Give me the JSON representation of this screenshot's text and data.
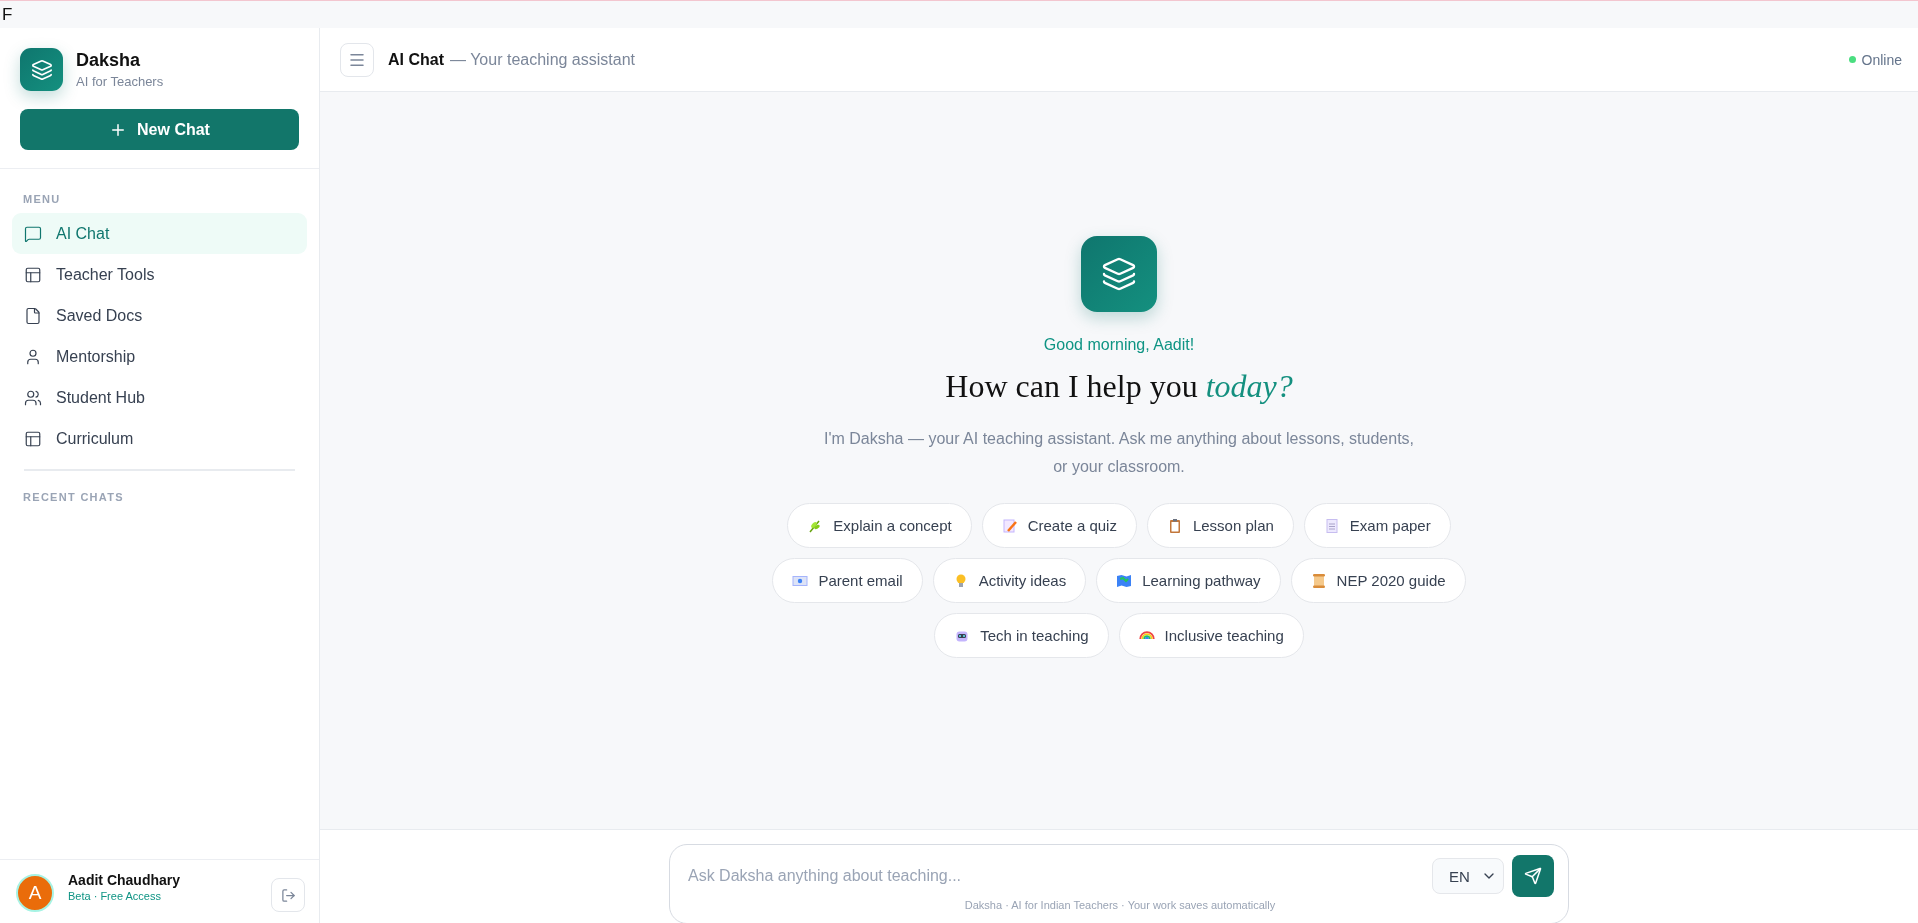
{
  "top_strip": {
    "text": "F"
  },
  "brand": {
    "name": "Daksha",
    "tagline": "AI for Teachers"
  },
  "new_chat": {
    "label": "New Chat"
  },
  "menu": {
    "heading": "MENU",
    "items": [
      {
        "label": "AI Chat",
        "kind": "chat",
        "selected": true
      },
      {
        "label": "Teacher Tools",
        "kind": "layout",
        "selected": false
      },
      {
        "label": "Saved Docs",
        "kind": "file",
        "selected": false
      },
      {
        "label": "Mentorship",
        "kind": "user",
        "selected": false
      },
      {
        "label": "Student Hub",
        "kind": "users",
        "selected": false
      },
      {
        "label": "Curriculum",
        "kind": "layout",
        "selected": false
      }
    ]
  },
  "recent_chats": {
    "heading": "RECENT CHATS"
  },
  "user": {
    "initial": "A",
    "name": "Aadit Chaudhary",
    "plan": "Beta · Free Access"
  },
  "header": {
    "title": "AI Chat",
    "subtitle": "— Your teaching assistant",
    "status": "Online",
    "online": true
  },
  "welcome": {
    "greeting": "Good morning, Aadit!",
    "heading": "How can I help you *today?*",
    "intro": "I'm Daksha — your AI teaching assistant. Ask me anything about lessons, students, or your classroom."
  },
  "suggestion_rows": [
    [
      {
        "label": "Explain a concept",
        "kind": "leaf"
      },
      {
        "label": "Create a quiz",
        "kind": "memo"
      },
      {
        "label": "Lesson plan",
        "kind": "clipboard"
      },
      {
        "label": "Exam paper",
        "kind": "page"
      }
    ],
    [
      {
        "label": "Parent email",
        "kind": "envelope"
      },
      {
        "label": "Activity ideas",
        "kind": "bulb"
      },
      {
        "label": "Learning pathway",
        "kind": "map"
      },
      {
        "label": "NEP 2020 guide",
        "kind": "scroll"
      }
    ],
    [
      {
        "label": "Tech in teaching",
        "kind": "robot"
      },
      {
        "label": "Inclusive teaching",
        "kind": "rainbow"
      }
    ]
  ],
  "composer": {
    "placeholder": "Ask Daksha anything about teaching...",
    "language": "EN",
    "footnote": "Daksha · AI for Indian Teachers · Your work saves automatically"
  }
}
